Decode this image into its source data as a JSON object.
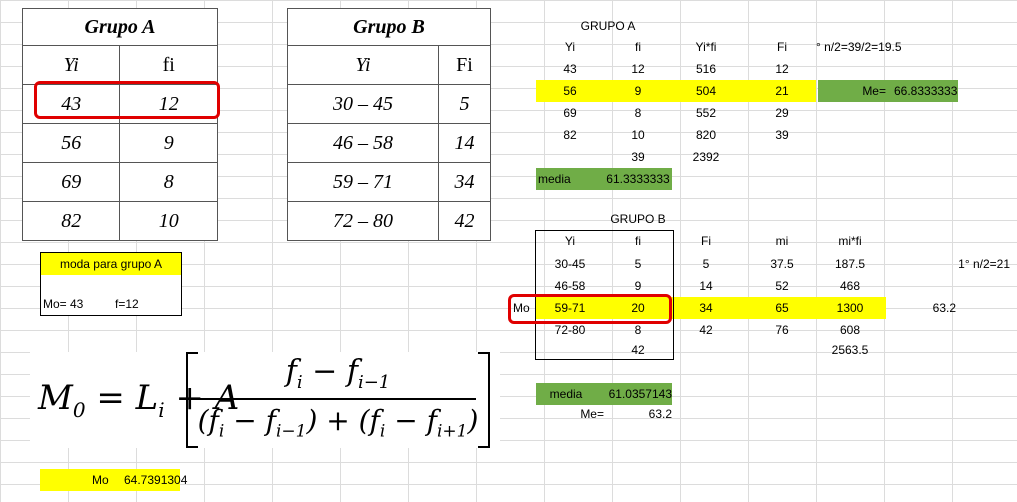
{
  "grupo_a_img": {
    "title": "Grupo A",
    "col1": "Yi",
    "col2": "fi",
    "rows": [
      [
        "43",
        "12"
      ],
      [
        "56",
        "9"
      ],
      [
        "69",
        "8"
      ],
      [
        "82",
        "10"
      ]
    ]
  },
  "grupo_b_img": {
    "title": "Grupo B",
    "col1": "Yi",
    "col2": "Fi",
    "rows": [
      [
        "30 – 45",
        "5"
      ],
      [
        "46 – 58",
        "14"
      ],
      [
        "59 – 71",
        "34"
      ],
      [
        "72 – 80",
        "42"
      ]
    ]
  },
  "moda_box": {
    "title": "moda para grupo A",
    "mo": "Mo= 43",
    "f": "f=12"
  },
  "formula": {
    "lhs": "M",
    "lhs_sub": "0",
    "eq": "= L",
    "li_sub": "i",
    "plus": "+ A",
    "num": "f",
    "num_sub1": "i",
    "minus": " − f",
    "num_sub2": "i−1",
    "den": "(f",
    "den_sub1": "i",
    "den_mid": " − f",
    "den_sub2": "i−1",
    "den_plus": ") + (f",
    "den_sub3": "i",
    "den_minus": " − f",
    "den_sub4": "i+1",
    "den_end": ")"
  },
  "mo_result": {
    "label": "Mo",
    "value": "64.7391304"
  },
  "sheet_a": {
    "title": "GRUPO A",
    "headers": [
      "Yi",
      "fi",
      "Yi*fi",
      "Fi"
    ],
    "note": "° n/2=39/2=19.5",
    "rows": [
      [
        "43",
        "12",
        "516",
        "12"
      ],
      [
        "56",
        "9",
        "504",
        "21"
      ],
      [
        "69",
        "8",
        "552",
        "29"
      ],
      [
        "82",
        "10",
        "820",
        "39"
      ]
    ],
    "totals": [
      "39",
      "2392"
    ],
    "me_label": "Me=",
    "me_value": "66.8333333",
    "media_label": "media",
    "media_value": "61.3333333"
  },
  "sheet_b": {
    "title": "GRUPO B",
    "headers": [
      "Yi",
      "fi",
      "Fi",
      "mi",
      "mi*fi"
    ],
    "note": "1° n/2=21",
    "rows": [
      [
        "30-45",
        "5",
        "5",
        "37.5",
        "187.5"
      ],
      [
        "46-58",
        "9",
        "14",
        "52",
        "468"
      ],
      [
        "59-71",
        "20",
        "34",
        "65",
        "1300"
      ],
      [
        "72-80",
        "8",
        "42",
        "76",
        "608"
      ]
    ],
    "mo_label": "Mo",
    "row3_extra": "63.2",
    "total_fi": "42",
    "total_mifi": "2563.5",
    "media_label": "media",
    "media_value": "61.0357143",
    "me_label": "Me=",
    "me_value": "63.2"
  },
  "colors": {
    "yellow": "#ffff00",
    "green": "#70ad47",
    "red": "#e00000"
  }
}
